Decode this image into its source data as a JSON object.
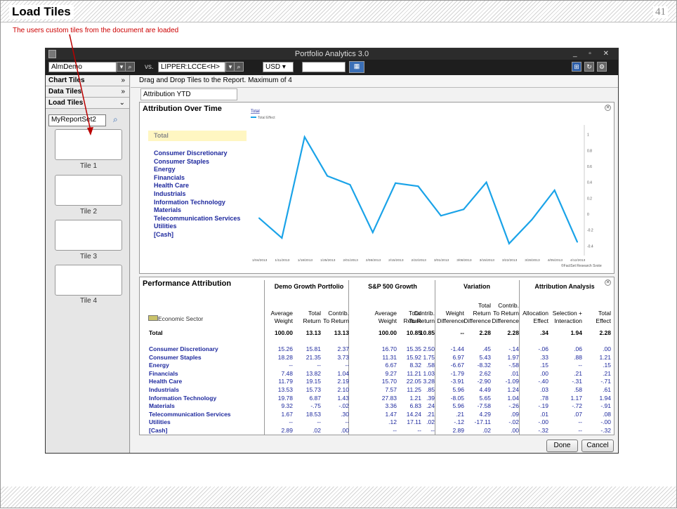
{
  "slide": {
    "title": "Load Tiles",
    "page_number": "41",
    "note": "The users custom tiles from the document are loaded"
  },
  "window": {
    "title": "Portfolio Analytics 3.0"
  },
  "toolbar": {
    "portfolio": "AlmDemo",
    "vs": "vs.",
    "benchmark": "LIPPER:LCCE<H>",
    "currency": "USD",
    "date_value": ""
  },
  "sidebar": {
    "sections": [
      {
        "label": "Chart Tiles",
        "chev": "»"
      },
      {
        "label": "Data Tiles",
        "chev": "»"
      },
      {
        "label": "Load Tiles",
        "chev": "«"
      }
    ],
    "search_value": "MyReportSet2",
    "tiles": [
      "Tile 1",
      "Tile 2",
      "Tile 3",
      "Tile 4"
    ]
  },
  "main": {
    "drag_note": "Drag and Drop Tiles to the Report. Maximum of 4",
    "tab_label": "Attribution YTD"
  },
  "chart_panel": {
    "title": "Attribution Over Time",
    "total_label": "Total",
    "sectors": [
      "Consumer Discretionary",
      "Consumer Staples",
      "Energy",
      "Financials",
      "Health Care",
      "Industrials",
      "Information Technology",
      "Materials",
      "Telecommunication Services",
      "Utilities",
      "[Cash]"
    ]
  },
  "chart_data": {
    "type": "line",
    "title": "Total",
    "series": [
      {
        "name": "Total Effect",
        "values": [
          -0.05,
          -0.3,
          0.97,
          0.48,
          0.37,
          -0.23,
          0.39,
          0.35,
          -0.02,
          0.06,
          0.4,
          -0.37,
          -0.07,
          0.3,
          -0.35
        ]
      }
    ],
    "x": [
      "1/04/2013",
      "1/11/2013",
      "1/18/2013",
      "1/25/2013",
      "2/01/2013",
      "2/08/2013",
      "2/15/2013",
      "2/22/2013",
      "3/01/2013",
      "3/08/2013",
      "3/15/2013",
      "3/22/2013",
      "3/28/2013",
      "4/05/2013",
      "4/12/2013"
    ],
    "ylim": [
      -0.45,
      1.05
    ],
    "yticks": [
      "1",
      "0.8",
      "0.6",
      "0.4",
      "0.2",
      "0",
      "-0.2",
      "-0.4"
    ],
    "color": "#1aa3e8",
    "credit": "©FactSet Research Systems",
    "grid": false,
    "legend": "top-left"
  },
  "perf_panel": {
    "title": "Performance Attribution",
    "groups": [
      "Demo Growth Portfolio",
      "S&P 500 Growth",
      "Variation",
      "Attribution Analysis"
    ],
    "col_headers": [
      [
        "Average",
        "Weight"
      ],
      [
        "Total",
        "Return"
      ],
      [
        "Contrib.",
        "To Return"
      ],
      [
        "Average",
        "Weight"
      ],
      [
        "Total",
        "Return"
      ],
      [
        "Contrib.",
        "To Return"
      ],
      [
        "Weight",
        "Difference"
      ],
      [
        "Total",
        "Return",
        "Difference"
      ],
      [
        "Contrib.",
        "To Return",
        "Difference"
      ],
      [
        "Allocation",
        "Effect"
      ],
      [
        "Selection +",
        "Interaction"
      ],
      [
        "Total",
        "Effect"
      ]
    ],
    "economic_sector_label": "Economic Sector",
    "total_row": {
      "label": "Total",
      "values": [
        "100.00",
        "13.13",
        "13.13",
        "100.00",
        "10.85",
        "10.85",
        "--",
        "2.28",
        "2.28",
        ".34",
        "1.94",
        "2.28"
      ]
    },
    "rows": [
      {
        "label": "Consumer Discretionary",
        "values": [
          "15.26",
          "15.81",
          "2.37",
          "16.70",
          "15.35",
          "2.50",
          "-1.44",
          ".45",
          "-.14",
          "-.06",
          ".06",
          ".00"
        ]
      },
      {
        "label": "Consumer Staples",
        "values": [
          "18.28",
          "21.35",
          "3.73",
          "11.31",
          "15.92",
          "1.75",
          "6.97",
          "5.43",
          "1.97",
          ".33",
          ".88",
          "1.21"
        ]
      },
      {
        "label": "Energy",
        "values": [
          "--",
          "--",
          "--",
          "6.67",
          "8.32",
          ".58",
          "-6.67",
          "-8.32",
          "-.58",
          ".15",
          "--",
          ".15"
        ]
      },
      {
        "label": "Financials",
        "values": [
          "7.48",
          "13.82",
          "1.04",
          "9.27",
          "11.21",
          "1.03",
          "-1.79",
          "2.62",
          ".01",
          ".00",
          ".21",
          ".21"
        ]
      },
      {
        "label": "Health Care",
        "values": [
          "11.79",
          "19.15",
          "2.19",
          "15.70",
          "22.05",
          "3.28",
          "-3.91",
          "-2.90",
          "-1.09",
          "-.40",
          "-.31",
          "-.71"
        ]
      },
      {
        "label": "Industrials",
        "values": [
          "13.53",
          "15.73",
          "2.10",
          "7.57",
          "11.25",
          ".85",
          "5.96",
          "4.49",
          "1.24",
          ".03",
          ".58",
          ".61"
        ]
      },
      {
        "label": "Information Technology",
        "values": [
          "19.78",
          "6.87",
          "1.43",
          "27.83",
          "1.21",
          ".39",
          "-8.05",
          "5.65",
          "1.04",
          ".78",
          "1.17",
          "1.94"
        ]
      },
      {
        "label": "Materials",
        "values": [
          "9.32",
          "-.75",
          "-.02",
          "3.36",
          "6.83",
          ".24",
          "5.96",
          "-7.58",
          "-.26",
          "-.19",
          "-.72",
          "-.91"
        ]
      },
      {
        "label": "Telecommunication Services",
        "values": [
          "1.67",
          "18.53",
          ".30",
          "1.47",
          "14.24",
          ".21",
          ".21",
          "4.29",
          ".09",
          ".01",
          ".07",
          ".08"
        ]
      },
      {
        "label": "Utilities",
        "values": [
          "--",
          "--",
          "--",
          ".12",
          "17.11",
          ".02",
          "-.12",
          "-17.11",
          "-.02",
          "-.00",
          "--",
          "-.00"
        ]
      },
      {
        "label": "[Cash]",
        "values": [
          "2.89",
          ".02",
          ".00",
          "--",
          "--",
          "--",
          "2.89",
          ".02",
          ".00",
          "-.32",
          "--",
          "-.32"
        ]
      }
    ]
  },
  "buttons": {
    "done": "Done",
    "cancel": "Cancel"
  }
}
